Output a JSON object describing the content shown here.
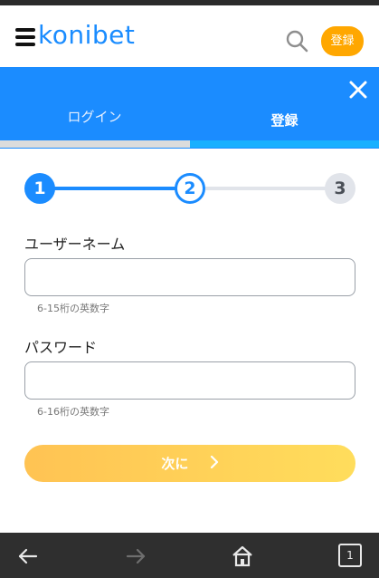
{
  "header": {
    "logo_text": "konibet",
    "register_label": "登録"
  },
  "tabs": [
    {
      "label": "ログイン",
      "active": false
    },
    {
      "label": "登録",
      "active": true
    }
  ],
  "stepper": {
    "steps": [
      "1",
      "2",
      "3"
    ],
    "current_step": 2,
    "completed_fraction": 0.5
  },
  "form": {
    "username": {
      "label": "ユーザーネーム",
      "value": "",
      "placeholder": "",
      "hint": "6-15桁の英数字"
    },
    "password": {
      "label": "パスワード",
      "value": "",
      "placeholder": "",
      "hint": "6-16桁の英数字"
    },
    "next_label": "次に"
  },
  "browser_nav": {
    "tab_count": "1"
  },
  "colors": {
    "brand_blue": "#1b8cff",
    "accent_orange": "#ffa700",
    "button_gradient_start": "#ffc353",
    "button_gradient_end": "#ffdd5c"
  },
  "icons": {
    "menu": "menu-icon",
    "search": "search-icon",
    "close": "close-icon",
    "next": "chevron-right-icon",
    "back": "arrow-left-icon",
    "forward": "arrow-right-icon",
    "home": "home-icon",
    "tabs": "tabs-icon"
  }
}
